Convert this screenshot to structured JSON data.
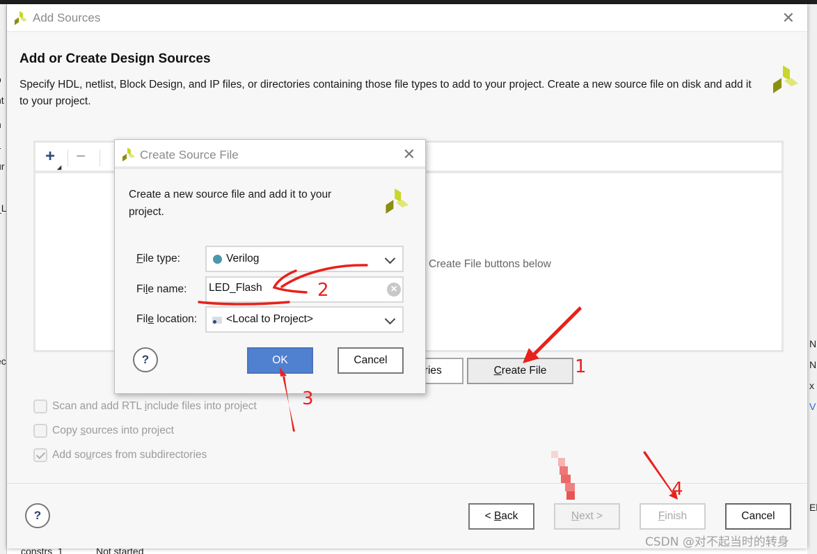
{
  "background": {
    "left_fragments": [
      "o",
      "nt",
      "n",
      "1",
      "ur",
      "_Li",
      "ec"
    ],
    "right_fragments": [
      "N",
      "N",
      "x",
      "V",
      "El"
    ],
    "bottom_fragments": [
      "constrs_1",
      "Not started"
    ]
  },
  "main_dialog": {
    "title": "Add Sources",
    "heading": "Add or Create Design Sources",
    "description": "Specify HDL, netlist, Block Design, and IP files, or directories containing those file types to add to your project. Create a new source file on disk and add it to your project.",
    "toolbar": {
      "add_icon": "+",
      "remove_icon": "−"
    },
    "empty_hint": "Create File buttons below",
    "add_directories_label_visible": "ories",
    "create_file_label": {
      "underline": "C",
      "rest": "reate File"
    },
    "options": [
      {
        "label_pre": "Scan and add RTL ",
        "underline": "i",
        "label_post": "nclude files into project",
        "checked": false
      },
      {
        "label_pre": "Copy ",
        "underline": "s",
        "label_post": "ources into project",
        "checked": false
      },
      {
        "label_pre": "Add so",
        "underline": "u",
        "label_post": "rces from subdirectories",
        "checked": true
      }
    ],
    "help_label": "?",
    "footer": {
      "back": {
        "pre": "< ",
        "underline": "B",
        "post": "ack"
      },
      "next": {
        "underline": "N",
        "post": "ext >"
      },
      "finish": {
        "underline": "F",
        "post": "inish"
      },
      "cancel": "Cancel"
    }
  },
  "create_source_dialog": {
    "title": "Create Source File",
    "description": "Create a new source file and add it to your project.",
    "file_type": {
      "label_underline": "F",
      "label_rest": "ile type:",
      "value": "Verilog",
      "dot_color": "#4a98ab"
    },
    "file_name": {
      "label_pre": "Fi",
      "label_underline": "l",
      "label_post": "e name:",
      "value": "LED_Flash"
    },
    "file_location": {
      "label_pre": "Fil",
      "label_underline": "e",
      "label_post": " location:",
      "value": "<Local to Project>"
    },
    "help_label": "?",
    "ok": "OK",
    "cancel": "Cancel"
  },
  "annotations": {
    "step1": "1",
    "step2": "2",
    "step3": "3",
    "step4": "4",
    "color": "#e8211c"
  },
  "watermark": "CSDN @对不起当时的转身"
}
